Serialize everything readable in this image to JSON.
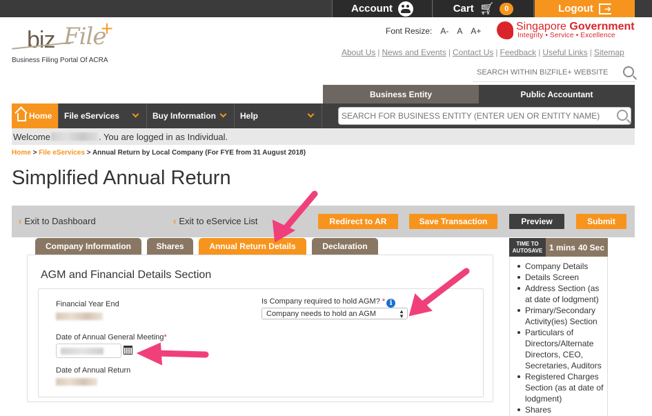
{
  "topbar": {
    "account_label": "Account",
    "cart_label": "Cart",
    "cart_count": "0",
    "logout_label": "Logout"
  },
  "header": {
    "logo_biz": "biz",
    "logo_file": "File",
    "logo_plus": "+",
    "logo_tagline": "Business Filing Portal Of ACRA",
    "font_resize_label": "Font Resize:",
    "font_sizes": [
      "A-",
      "A",
      "A+"
    ],
    "gov_title_a": "Singapore ",
    "gov_title_b": "Government",
    "gov_tagline": "Integrity • Service • Excellence",
    "links": [
      "About Us",
      "News and Events",
      "Contact Us",
      "Feedback",
      "Useful Links",
      "Sitemap"
    ],
    "site_search_placeholder": "SEARCH WITHIN BIZFILE+ WEBSITE"
  },
  "entity_tabs": {
    "business_entity": "Business Entity",
    "public_accountant": "Public Accountant"
  },
  "nav": {
    "home": "Home",
    "file_eservices": "File eServices",
    "buy_information": "Buy Information",
    "help": "Help",
    "entity_search_placeholder": "SEARCH FOR BUSINESS ENTITY (ENTER UEN OR ENTITY NAME)"
  },
  "welcome": {
    "prefix": "Welcome ",
    "suffix": ". You are logged in as Individual."
  },
  "breadcrumb": {
    "home": "Home",
    "file_eservices": "File eServices",
    "current": "Annual Return by Local Company (For FYE from 31 August 2018)"
  },
  "page_title": "Simplified Annual Return",
  "actions": {
    "exit_dashboard": "Exit to Dashboard",
    "exit_eservice": "Exit to eService List",
    "redirect_ar": "Redirect to AR",
    "save": "Save Transaction",
    "preview": "Preview",
    "submit": "Submit"
  },
  "section_tabs": [
    "Company Information",
    "Shares",
    "Annual Return Details",
    "Declaration"
  ],
  "section": {
    "title": "AGM and Financial Details Section",
    "fye_label": "Financial Year End",
    "agm_date_label": "Date of Annual General Meeting",
    "ar_date_label": "Date of Annual Return",
    "agm_required_label": "Is Company required to hold AGM?",
    "agm_required_value": "Company needs to hold an AGM",
    "required_mark": "*",
    "info_icon": "i"
  },
  "autosave": {
    "label_line1": "TIME TO",
    "label_line2": "AUTOSAVE",
    "minutes": "1 mins",
    "seconds": "40 Sec"
  },
  "sidenav": [
    "Company Details",
    "Details Screen",
    "Address Section (as at date of lodgment)",
    "Primary/Secondary Activity(ies) Section",
    "Particulars of Directors/Alternate Directors, CEO, Secretaries, Auditors",
    "Registered Charges Section (as at date of lodgment)",
    "Shares"
  ],
  "colors": {
    "accent": "#f7941d",
    "dark": "#3f3f3f",
    "tab_brown": "#8a7763",
    "annotation_arrow": "#f0407a"
  }
}
